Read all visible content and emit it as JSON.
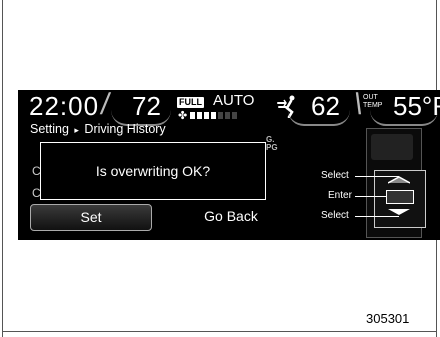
{
  "status_bar": {
    "time": "22:00",
    "driver_temp": "72",
    "fan_mode_badge": "FULL",
    "fan_mode": "AUTO",
    "fan_level": 0.4,
    "passenger_temp": "62",
    "outside_temp_label_line1": "OUT",
    "outside_temp_label_line2": "TEMP",
    "outside_temp": "55°F"
  },
  "breadcrumb": {
    "parent": "Setting",
    "separator": "▸",
    "current": "Driving History"
  },
  "background": {
    "partial_text": "G.\nPG",
    "row_glyph_1": "C",
    "row_glyph_2": "C"
  },
  "dialog": {
    "message": "Is overwriting OK?"
  },
  "buttons": {
    "set_label": "Set",
    "go_back_label": "Go Back"
  },
  "controller_callouts": {
    "top": "Select",
    "middle": "Enter",
    "bottom": "Select"
  },
  "figure": {
    "number": "305301"
  },
  "colors": {
    "screen_bg": "#000000",
    "text": "#ffffff"
  }
}
